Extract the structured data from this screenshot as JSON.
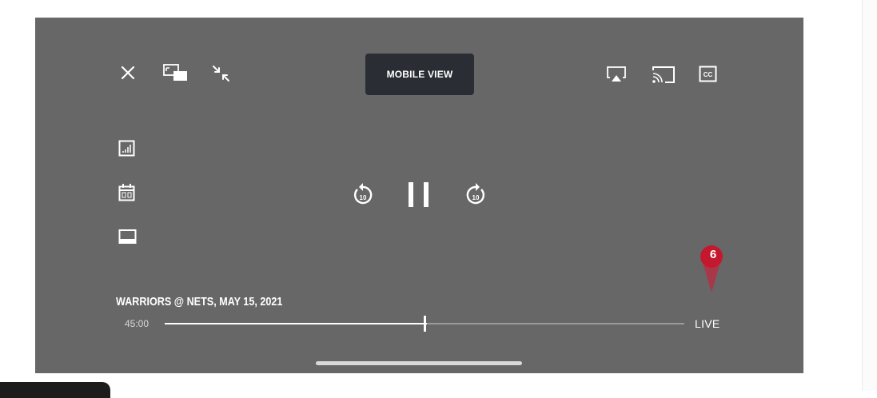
{
  "player": {
    "mobile_view_label": "MOBILE VIEW",
    "game_title": "WARRIORS @ NETS, MAY 15, 2021",
    "elapsed_time": "45:00",
    "live_label": "LIVE",
    "progress": 0.505,
    "background_color": "#676767"
  },
  "badge": {
    "value": "6",
    "color": "#c4182f"
  },
  "icons": {
    "top_left": [
      "close-icon",
      "picture-in-picture-icon",
      "minimize-icon"
    ],
    "top_right": [
      "airplay-icon",
      "cast-icon",
      "closed-captions-icon"
    ],
    "side": [
      "stats-icon",
      "schedule-icon",
      "mini-player-icon"
    ],
    "center": [
      "rewind-10-icon",
      "pause-icon",
      "forward-10-icon"
    ]
  }
}
